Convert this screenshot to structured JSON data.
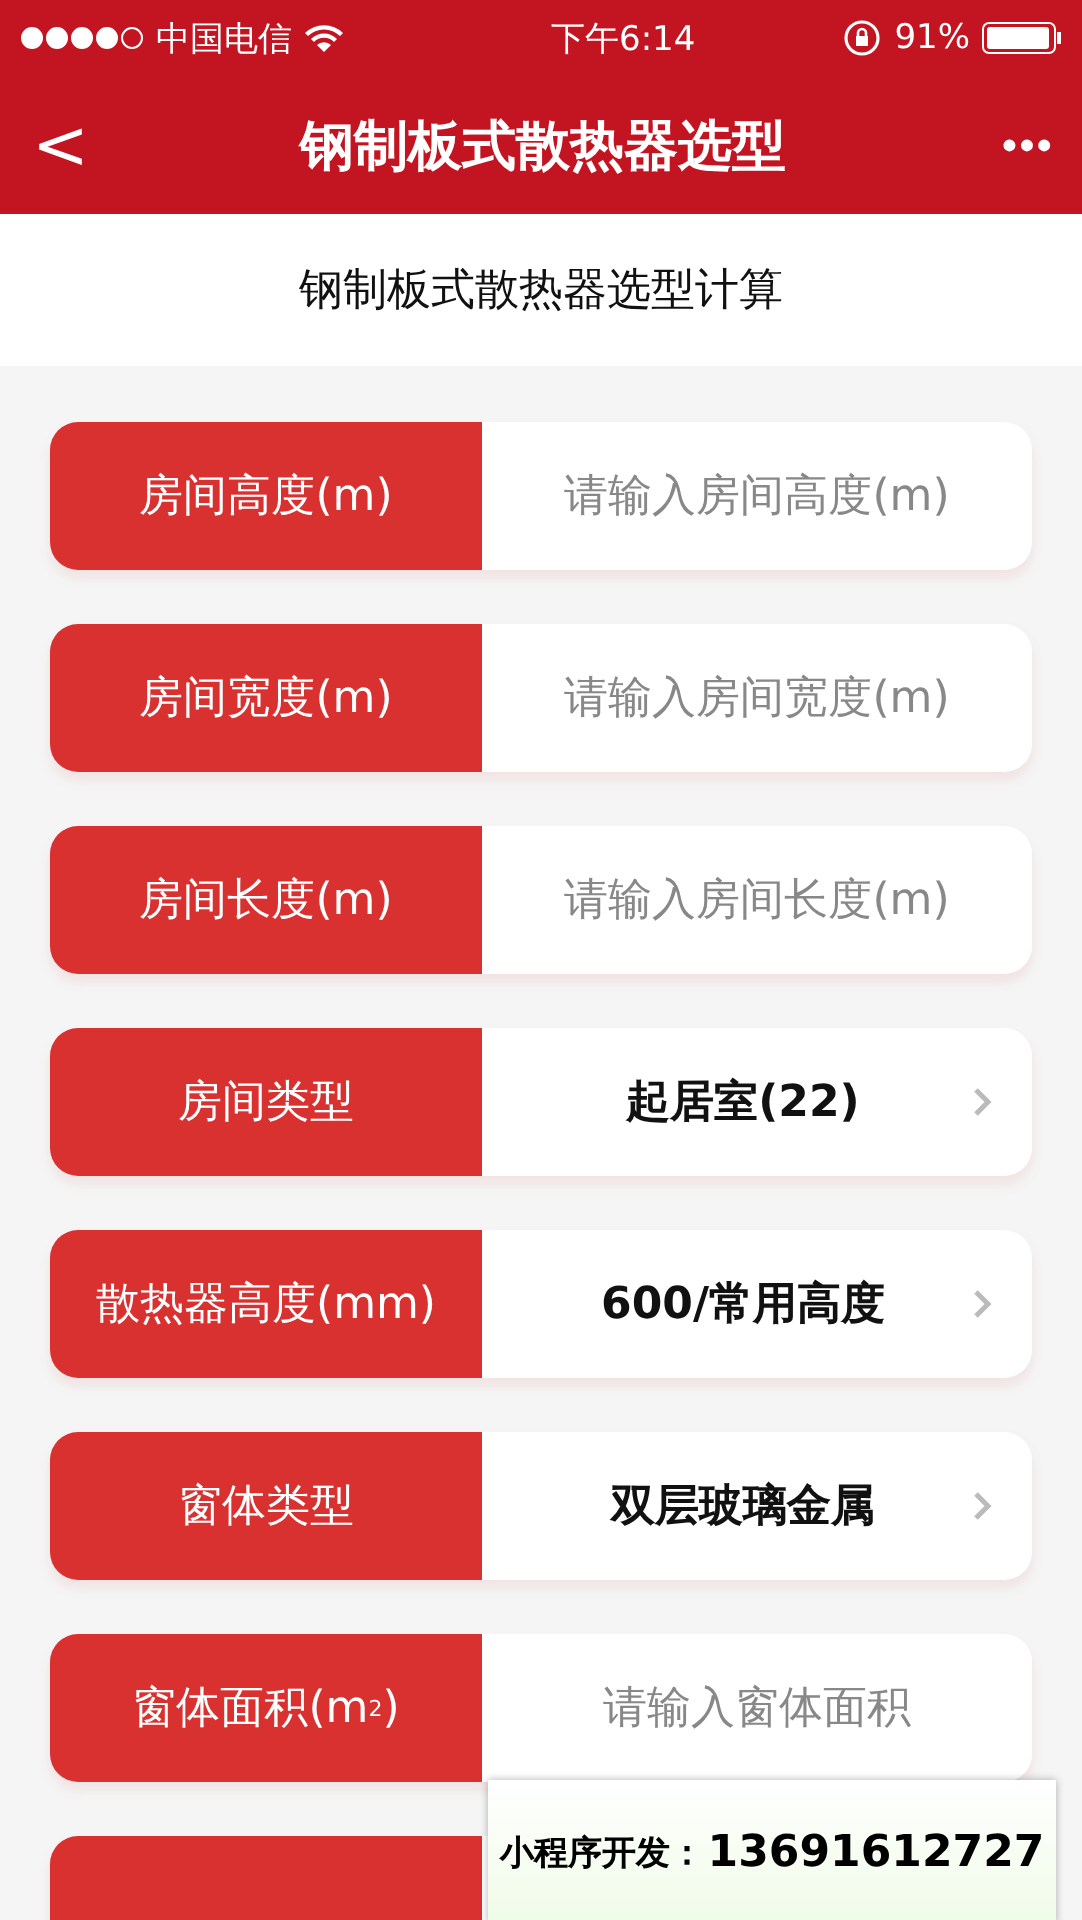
{
  "status_bar": {
    "carrier": "中国电信",
    "time": "下午6:14",
    "battery": "91%"
  },
  "nav": {
    "back": "<",
    "title": "钢制板式散热器选型",
    "more": "•••"
  },
  "subtitle": "钢制板式散热器选型计算",
  "fields": [
    {
      "kind": "input",
      "label": "房间高度(m)",
      "placeholder": "请输入房间高度(m)"
    },
    {
      "kind": "input",
      "label": "房间宽度(m)",
      "placeholder": "请输入房间宽度(m)"
    },
    {
      "kind": "input",
      "label": "房间长度(m)",
      "placeholder": "请输入房间长度(m)"
    },
    {
      "kind": "select",
      "label": "房间类型",
      "value": "起居室(22)"
    },
    {
      "kind": "select",
      "label": "散热器高度(mm)",
      "value": "600/常用高度"
    },
    {
      "kind": "select",
      "label": "窗体类型",
      "value": "双层玻璃金属"
    },
    {
      "kind": "input",
      "label": "窗体面积(m$^{2}$)",
      "placeholder": "请输入窗体面积"
    }
  ],
  "popup": {
    "label": "小程序开发：",
    "phone": "13691612727"
  }
}
